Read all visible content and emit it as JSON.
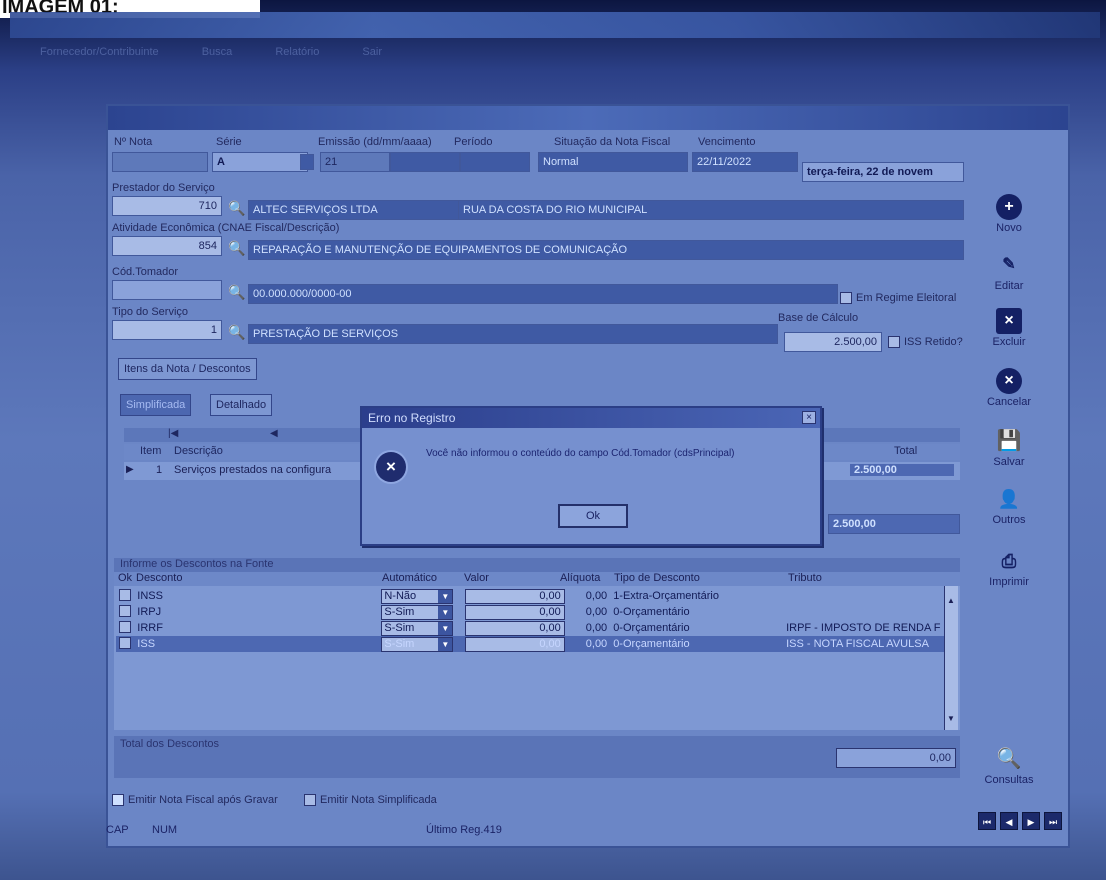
{
  "caption": "IMAGEM 01:",
  "toolbar_blur": [
    "Fornecedor/Contribuinte",
    "Busca",
    "Relatório",
    "Sair"
  ],
  "header": {
    "nota_label": "Nº Nota",
    "serie_label": "Série",
    "serie_value": "A",
    "emissao_label": "Emissão (dd/mm/aaaa)",
    "emissao_value": "21",
    "periodo_label": "Período",
    "situacao_label": "Situação da Nota Fiscal",
    "situacao_value": "Normal",
    "vencimento_label": "Vencimento",
    "vencimento_value": "22/11/2022",
    "date_long": "terça-feira, 22 de novem"
  },
  "form": {
    "prestador_label": "Prestador do Serviço",
    "prestador_code": "710",
    "prestador_name": "ALTEC SERVIÇOS LTDA",
    "prestador_extra": "RUA DA COSTA DO RIO MUNICIPAL",
    "atividade_label": "Atividade Econômica (CNAE Fiscal/Descrição)",
    "atividade_code": "854",
    "atividade_desc": "REPARAÇÃO E MANUTENÇÃO DE EQUIPAMENTOS DE COMUNICAÇÃO",
    "tomador_label": "Cód.Tomador",
    "tomador_doc": "00.000.000/0000-00",
    "regime_label": "Em Regime Eleitoral",
    "tipo_label": "Tipo do Serviço",
    "tipo_code": "1",
    "tipo_desc": "PRESTAÇÃO DE SERVIÇOS",
    "base_label": "Base de Cálculo",
    "base_value": "2.500,00",
    "iss_retido_label": "ISS Retido?"
  },
  "tabs": {
    "itens": "Itens da Nota / Descontos",
    "simplificada": "Simplificada",
    "detalhado": "Detalhado"
  },
  "items": {
    "col_item": "Item",
    "col_desc": "Descrição",
    "col_total": "Total",
    "row_item": "1",
    "row_desc": "Serviços prestados na configura",
    "row_total": "2.500,00",
    "sum_total": "2.500,00"
  },
  "descontos": {
    "title": "Informe os Descontos na Fonte",
    "headers": [
      "Ok",
      "Desconto",
      "Automático",
      "Valor",
      "Alíquota",
      "Tipo de Desconto",
      "Tributo"
    ],
    "rows": [
      {
        "nome": "INSS",
        "auto": "N-Não",
        "valor": "0,00",
        "aliquota": "0,00",
        "tipo": "1-Extra-Orçamentário",
        "tributo": ""
      },
      {
        "nome": "IRPJ",
        "auto": "S-Sim",
        "valor": "0,00",
        "aliquota": "0,00",
        "tipo": "0-Orçamentário",
        "tributo": ""
      },
      {
        "nome": "IRRF",
        "auto": "S-Sim",
        "valor": "0,00",
        "aliquota": "0,00",
        "tipo": "0-Orçamentário",
        "tributo": "IRPF - IMPOSTO DE RENDA F"
      },
      {
        "nome": "ISS",
        "auto": "S-Sim",
        "valor": "0,00",
        "aliquota": "0,00",
        "tipo": "0-Orçamentário",
        "tributo": "ISS - NOTA FISCAL AVULSA"
      }
    ],
    "total_label": "Total dos Descontos",
    "total_value": "0,00"
  },
  "options": {
    "emitir_nota": "Emitir Nota Fiscal após Gravar",
    "emitir_simplificada": "Emitir Nota Simplificada"
  },
  "sidebar": {
    "novo": "Novo",
    "editar": "Editar",
    "excluir": "Excluir",
    "cancelar": "Cancelar",
    "salvar": "Salvar",
    "outros": "Outros",
    "imprimir": "Imprimir",
    "consultas": "Consultas"
  },
  "status": {
    "cap": "CAP",
    "num": "NUM",
    "ultimo": "Último Reg.419"
  },
  "dialog": {
    "title": "Erro no Registro",
    "message": "Você não informou o conteúdo do campo Cód.Tomador (cdsPrincipal)",
    "ok": "Ok"
  },
  "colors": {
    "accent": "#2b3e86",
    "panel": "#6b86c6",
    "selected_row": "#4d68b2"
  }
}
